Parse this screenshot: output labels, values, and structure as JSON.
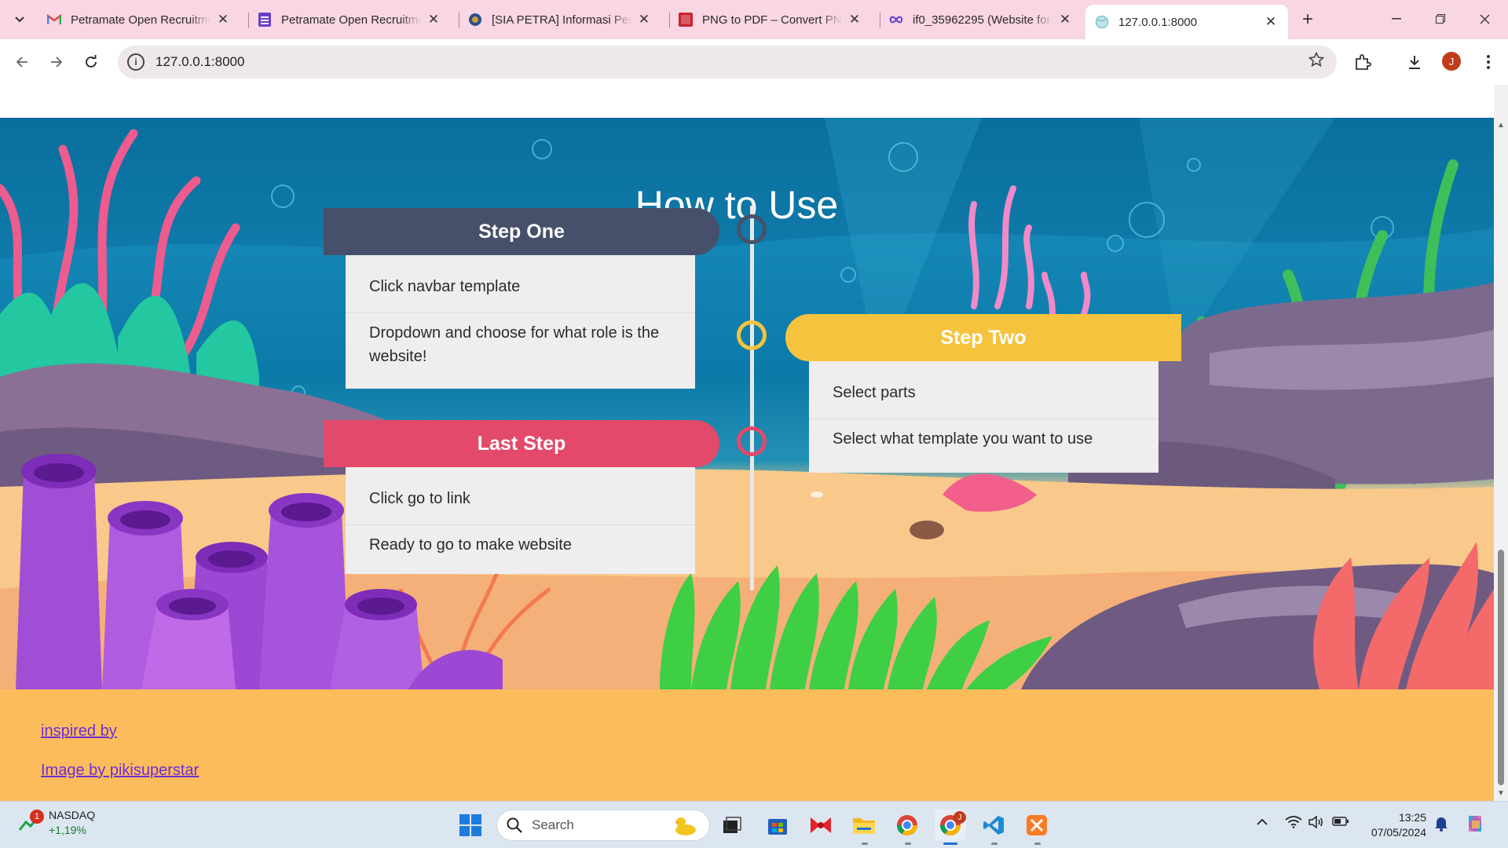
{
  "browser": {
    "tabs": [
      {
        "title": "Petramate Open Recruitment",
        "icon": "gmail-icon"
      },
      {
        "title": "Petramate Open Recruitment",
        "icon": "forms-icon"
      },
      {
        "title": "[SIA PETRA] Informasi Perc",
        "icon": "sia-petra-icon"
      },
      {
        "title": "PNG to PDF – Convert PNG",
        "icon": "png-pdf-icon"
      },
      {
        "title": "if0_35962295 (Website for",
        "icon": "infinity-icon"
      },
      {
        "title": "127.0.0.1:8000",
        "icon": "globe-icon"
      }
    ],
    "close_glyph": "✕",
    "new_tab_glyph": "+",
    "address": "127.0.0.1:8000",
    "profile_initial": "J",
    "colors": {
      "tabstrip": "#f9d6e4",
      "omnibox": "#efe8eb"
    }
  },
  "page": {
    "heading": "How to Use",
    "steps": [
      {
        "title": "Step One",
        "color": "#46506a",
        "items": [
          "Click navbar template",
          "Dropdown and choose for what role is the website!"
        ]
      },
      {
        "title": "Step Two",
        "color": "#f6c33f",
        "items": [
          "Select parts",
          "Select what template you want to use"
        ]
      },
      {
        "title": "Last Step",
        "color": "#e2496a",
        "items": [
          "Click go to link",
          "Ready to go to make website"
        ]
      }
    ],
    "footer": {
      "links": [
        "inspired by",
        "Image by pikisuperstar"
      ],
      "background": "#fdbc5c",
      "link_color": "#6b2fd6"
    }
  },
  "taskbar": {
    "stock": {
      "name": "NASDAQ",
      "change": "+1,19%",
      "badge": "1"
    },
    "search_placeholder": "Search",
    "clock": {
      "time": "13:25",
      "date": "07/05/2024"
    },
    "profile_badge": "J"
  }
}
